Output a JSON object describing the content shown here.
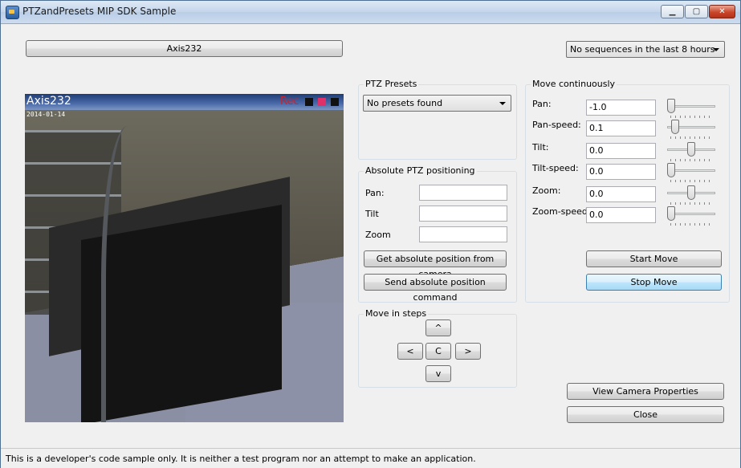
{
  "window": {
    "title": "PTZandPresets MIP SDK Sample",
    "minimize": "▁",
    "maximize": "▢",
    "close": "✕"
  },
  "camera_button": "Axis232",
  "sequence_combo": "No sequences in the last 8 hours",
  "video": {
    "camera_name": "Axis232",
    "rec_label": "Rec",
    "date": "2014-01-14",
    "indicator_colors": [
      "#111111",
      "#e0306a",
      "#111111"
    ]
  },
  "ptz_presets": {
    "title": "PTZ Presets",
    "combo": "No presets found"
  },
  "absolute": {
    "title": "Absolute PTZ positioning",
    "pan_label": "Pan:",
    "tilt_label": "Tilt",
    "zoom_label": "Zoom",
    "pan_value": "",
    "tilt_value": "",
    "zoom_value": "",
    "get_button": "Get absolute position from camera",
    "send_button": "Send absolute position command"
  },
  "steps": {
    "title": "Move in steps",
    "up": "^",
    "left": "<",
    "center": "C",
    "right": ">",
    "down": "v"
  },
  "continuous": {
    "title": "Move continuously",
    "rows": [
      {
        "label": "Pan:",
        "value": "-1.0",
        "slider": 0.0
      },
      {
        "label": "Pan-speed:",
        "value": "0.1",
        "slider": 0.1
      },
      {
        "label": "Tilt:",
        "value": "0.0",
        "slider": 0.5
      },
      {
        "label": "Tilt-speed:",
        "value": "0.0",
        "slider": 0.0
      },
      {
        "label": "Zoom:",
        "value": "0.0",
        "slider": 0.5
      },
      {
        "label": "Zoom-speed:",
        "value": "0.0",
        "slider": 0.0
      }
    ],
    "start_button": "Start Move",
    "stop_button": "Stop Move"
  },
  "view_properties_button": "View Camera Properties",
  "close_button": "Close",
  "status_text": "This is a developer's code sample only. It is neither a test program nor an attempt to make an application."
}
